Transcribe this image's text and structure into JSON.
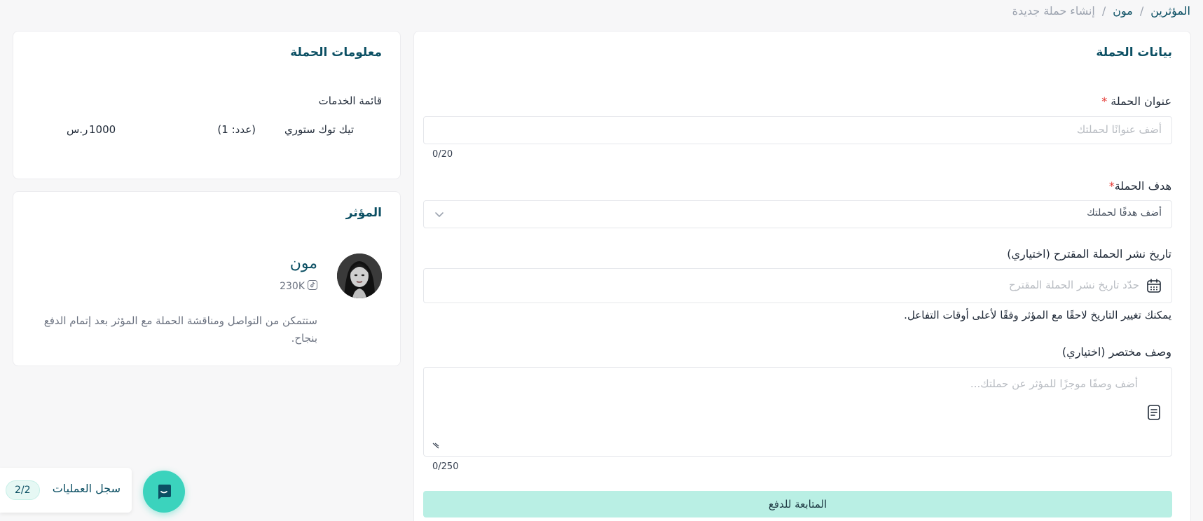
{
  "breadcrumb": {
    "items": [
      "المؤثرين",
      "مون"
    ],
    "separator": "/",
    "current": "إنشاء حملة جديدة"
  },
  "main": {
    "title": "بيانات الحملة",
    "campaign_title": {
      "label": "عنوان الحملة",
      "required": "*",
      "placeholder": "أضف عنوانًا لحملتك",
      "counter": "0/20"
    },
    "campaign_goal": {
      "label": "هدف الحملة",
      "required": "*",
      "placeholder": "أضف هدفًا لحملتك"
    },
    "publish_date": {
      "label": "تاريخ نشر الحملة المقترح (اختياري)",
      "placeholder": "حدّد تاريخ نشر الحملة المقترح",
      "hint": "يمكنك تغيير التاريخ لاحقًا مع المؤثر وفقًا لأعلى أوقات التفاعل."
    },
    "description": {
      "label": "وصف مختصر (اختياري)",
      "placeholder": "أضف وصفًا موجزًا للمؤثر عن حملتك...",
      "counter": "0/250"
    },
    "submit_label": "المتابعة للدفع"
  },
  "info": {
    "title": "معلومات الحملة",
    "services_heading": "قائمة الخدمات",
    "services": [
      {
        "name": "تيك توك ستوري",
        "count": "(عدد: 1)",
        "price": "1000",
        "currency": "ر.س"
      }
    ]
  },
  "influencer": {
    "title": "المؤثر",
    "name": "مون",
    "followers": "230K",
    "platform_icon": "tiktok-icon",
    "note": "ستتمكن من التواصل ومناقشة الحملة مع المؤثر بعد إتمام الدفع بنجاح."
  },
  "ops": {
    "label": "سجل العمليات",
    "badge": "2/2"
  },
  "colors": {
    "accent": "#3bd3bd",
    "primary_text": "#0b4f63",
    "submit_bg": "#b9efe4"
  }
}
